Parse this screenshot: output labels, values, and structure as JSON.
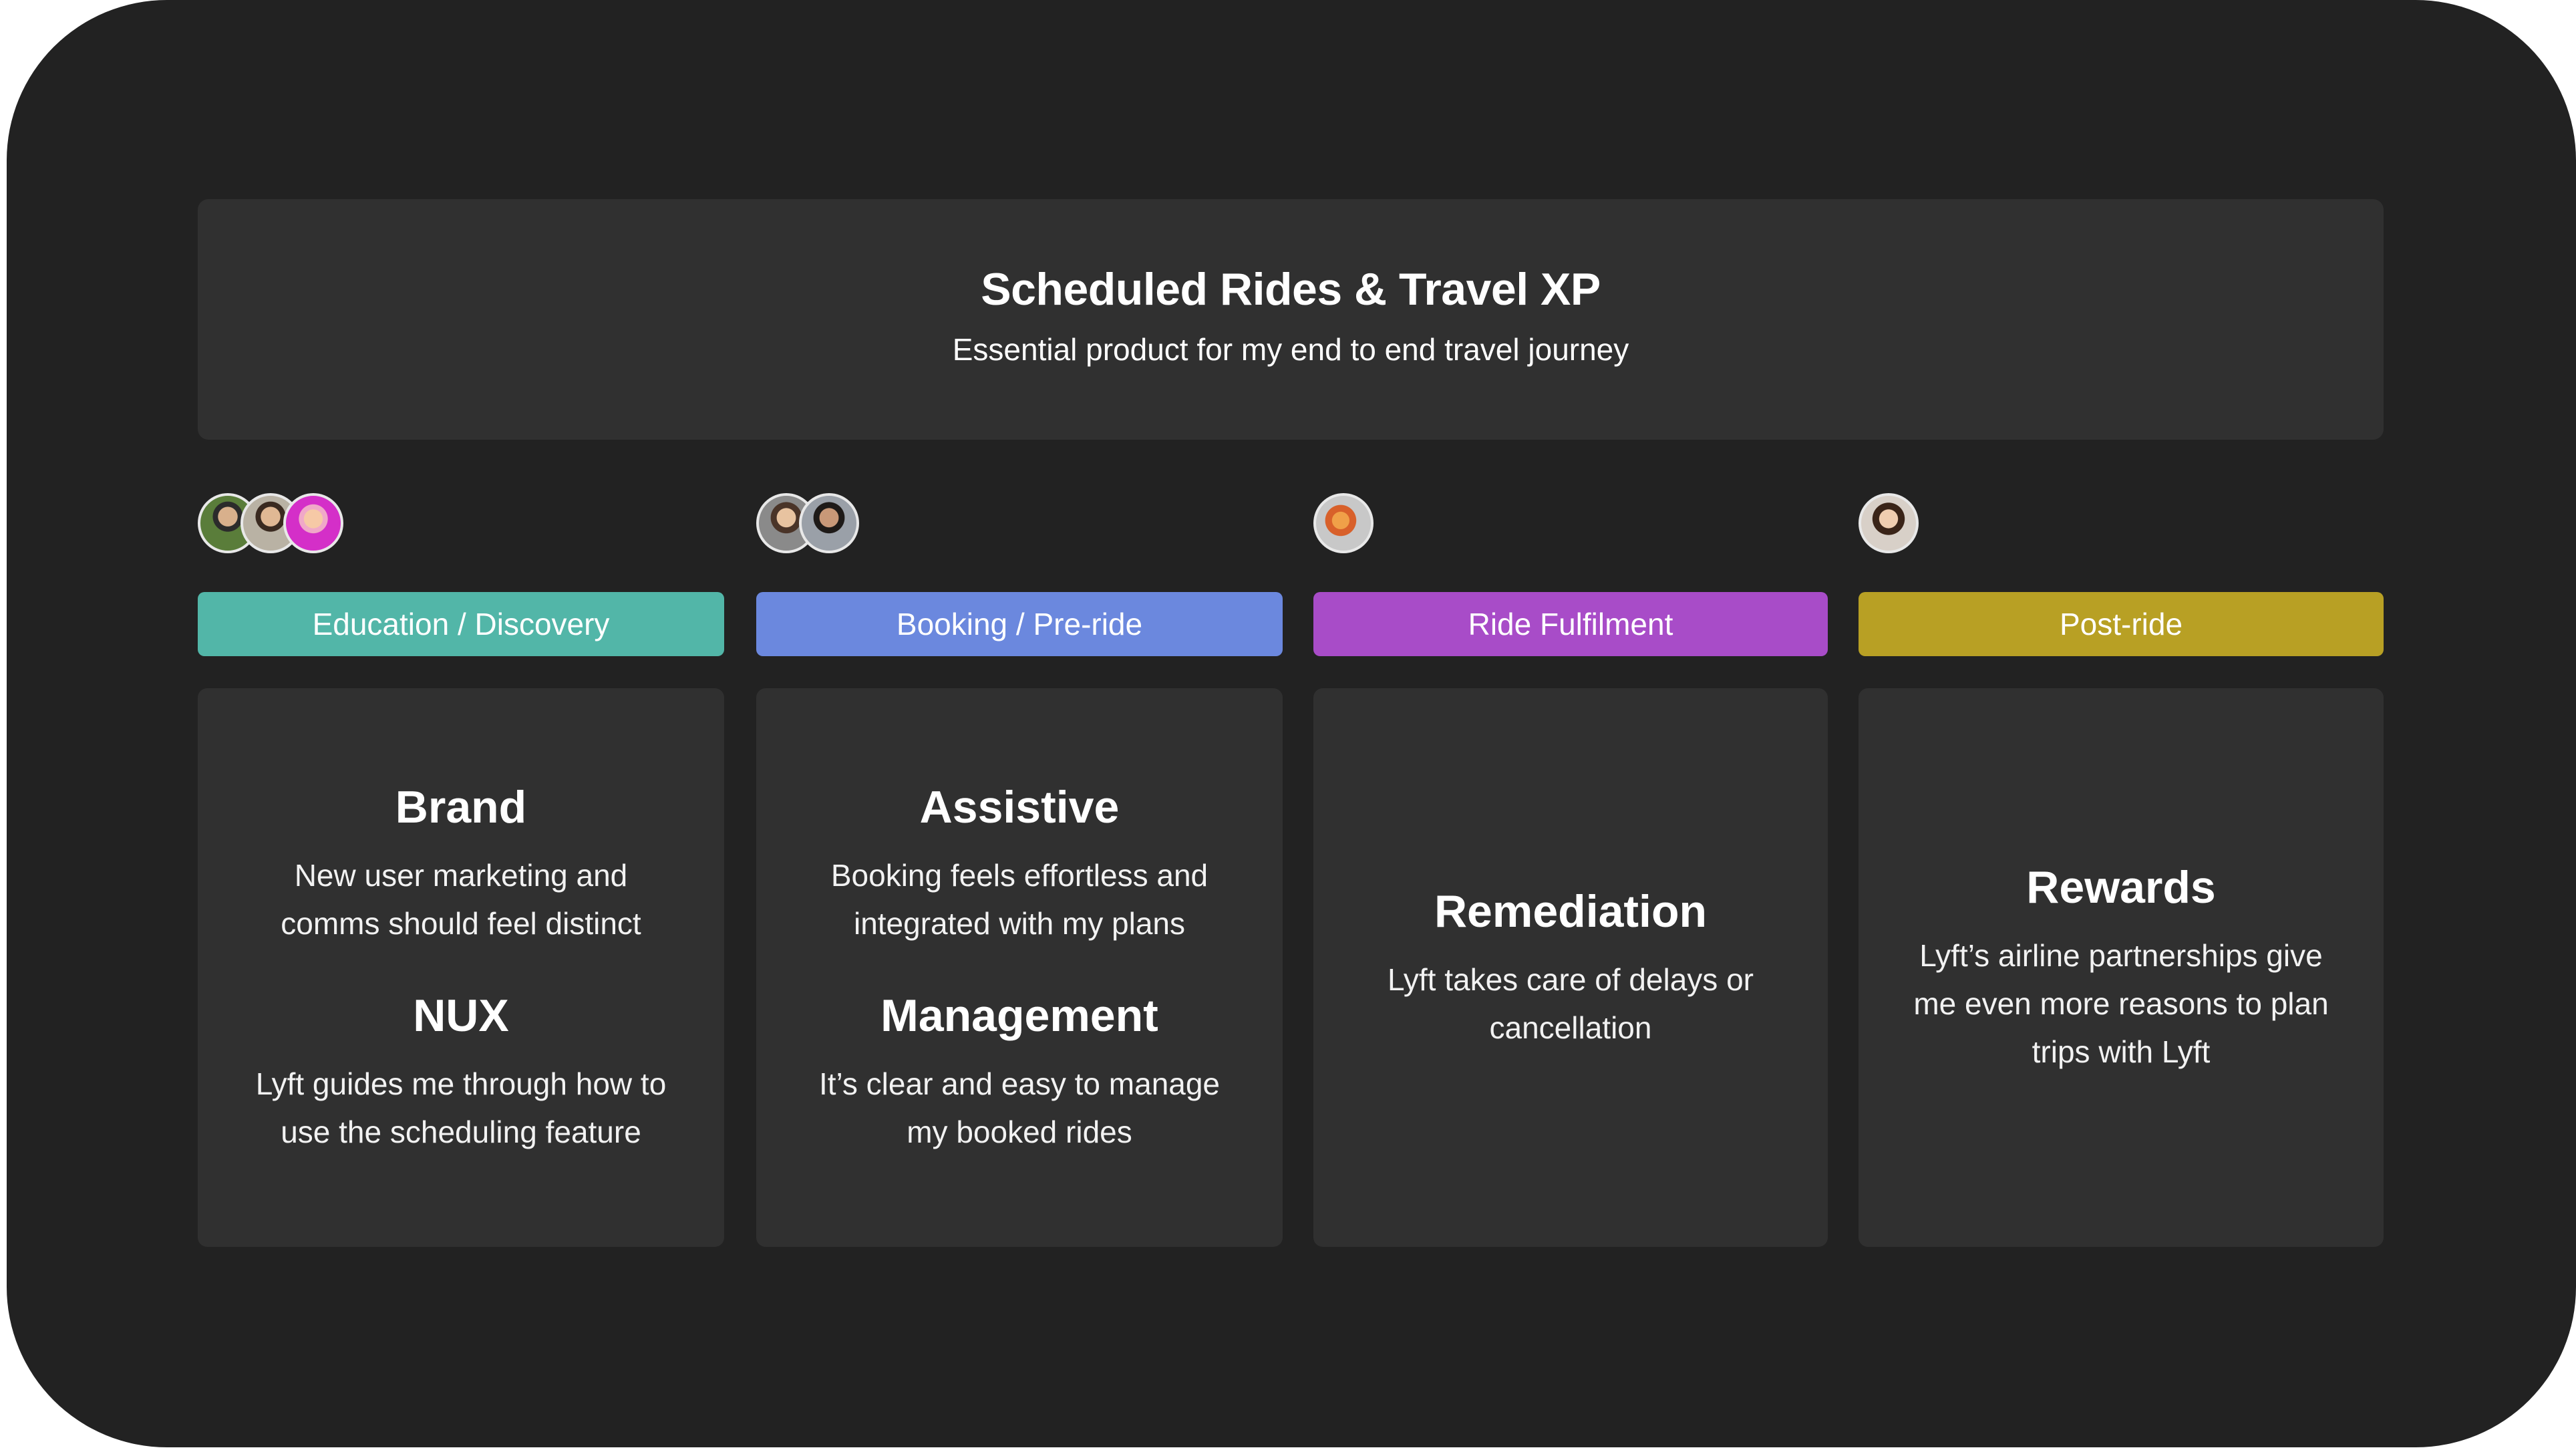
{
  "header": {
    "title": "Scheduled Rides & Travel XP",
    "subtitle": "Essential product for my end to end travel journey"
  },
  "columns": [
    {
      "stage": "Education / Discovery",
      "color": "#52b6a8",
      "blocks": [
        {
          "title": "Brand",
          "lines": [
            "New user marketing and",
            "comms should feel distinct"
          ]
        },
        {
          "title": "NUX",
          "lines": [
            "Lyft guides me through how to",
            "use the scheduling feature"
          ]
        }
      ]
    },
    {
      "stage": "Booking / Pre-ride",
      "color": "#6b88de",
      "blocks": [
        {
          "title": "Assistive",
          "lines": [
            "Booking feels effortless and",
            "integrated with my plans"
          ]
        },
        {
          "title": "Management",
          "lines": [
            "It’s clear and easy to manage",
            "my booked rides"
          ]
        }
      ]
    },
    {
      "stage": "Ride Fulfilment",
      "color": "#a84cc8",
      "blocks": [
        {
          "title": "Remediation",
          "lines": [
            "Lyft takes care of delays or",
            "cancellation"
          ]
        }
      ]
    },
    {
      "stage": "Post-ride",
      "color": "#b8a024",
      "blocks": [
        {
          "title": "Rewards",
          "lines": [
            "Lyft’s airline partnerships give",
            "me even more reasons to plan",
            "trips with Lyft"
          ]
        }
      ]
    }
  ]
}
